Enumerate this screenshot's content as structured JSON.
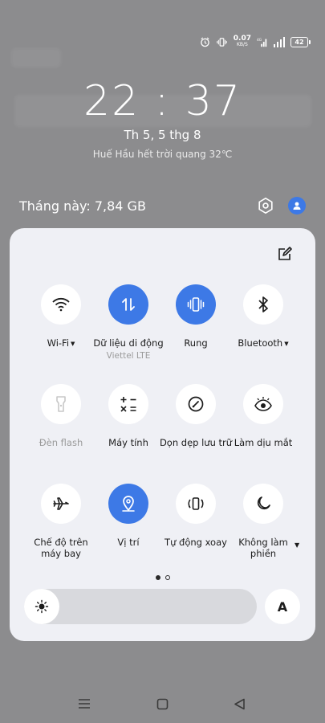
{
  "status_bar": {
    "net_speed_value": "0.07",
    "net_speed_unit": "KB/S",
    "battery_level": "42"
  },
  "lockscreen": {
    "time": "22 : 37",
    "date": "Th 5, 5 thg 8",
    "weather": "Huế Hầu hết trời quang 32℃"
  },
  "header": {
    "data_usage": "Tháng này: 7,84 GB"
  },
  "quick_settings": {
    "row1": [
      {
        "label": "Wi-Fi",
        "active": false,
        "icon": "wifi-icon",
        "has_caret": true
      },
      {
        "label": "Dữ liệu di động",
        "sub": "Viettel LTE",
        "active": true,
        "icon": "mobile-data-icon"
      },
      {
        "label": "Rung",
        "active": true,
        "icon": "vibrate-icon"
      },
      {
        "label": "Bluetooth",
        "active": false,
        "icon": "bluetooth-icon",
        "has_caret": true
      }
    ],
    "row2": [
      {
        "label": "Đèn flash",
        "active": false,
        "disabled": true,
        "icon": "flashlight-icon"
      },
      {
        "label": "Máy tính",
        "active": false,
        "icon": "calculator-icon"
      },
      {
        "label": "Dọn dẹp lưu trữ",
        "active": false,
        "icon": "cleanup-icon"
      },
      {
        "label": "Làm dịu mắt",
        "active": false,
        "icon": "eye-comfort-icon"
      }
    ],
    "row3": [
      {
        "label": "Chế độ trên máy bay",
        "active": false,
        "icon": "airplane-icon"
      },
      {
        "label": "Vị trí",
        "active": true,
        "icon": "location-icon"
      },
      {
        "label": "Tự động xoay",
        "active": false,
        "icon": "auto-rotate-icon"
      },
      {
        "label": "Không làm phiền",
        "active": false,
        "icon": "moon-icon",
        "has_caret": true
      }
    ],
    "page_count": 2,
    "active_page": 1,
    "auto_brightness_label": "A",
    "brightness_level": 0.0
  },
  "colors": {
    "accent": "#3d79e6",
    "panel": "#eff0f5",
    "backdrop": "#8c8c8e"
  }
}
